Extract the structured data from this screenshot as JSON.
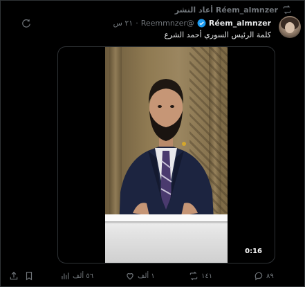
{
  "repost": {
    "text": "Réem_almnzer أعاد النشر",
    "icon": "repost-icon"
  },
  "author": {
    "display_name": "Réem_almnzer",
    "handle": "@Reemmnzer",
    "separator": "·",
    "time": "٢١ س",
    "verified_icon": "verified-badge-icon",
    "avatar_icon": "avatar"
  },
  "tweet": {
    "text": "كلمة الرئيس السوري أحمد الشرع"
  },
  "video": {
    "duration": "0:16"
  },
  "actions": {
    "replies": "٨٩",
    "reposts": "١٤١",
    "likes": "١ ألف",
    "views": "٥٦ ألف"
  },
  "colors": {
    "background": "#000000",
    "muted": "#71767b",
    "text": "#e7e9ea",
    "verified": "#1d9bf0"
  }
}
